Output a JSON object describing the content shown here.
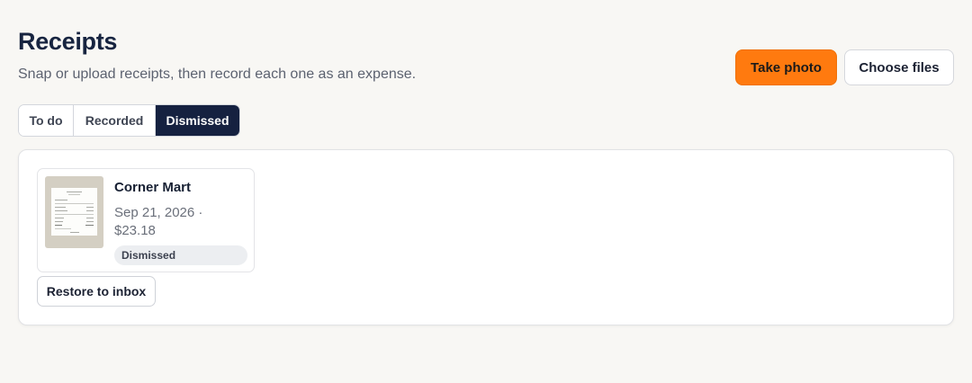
{
  "header": {
    "title": "Receipts",
    "subtitle": "Snap or upload receipts, then record each one as an expense."
  },
  "actions": {
    "take_photo": "Take photo",
    "choose_files": "Choose files"
  },
  "tabs": [
    {
      "label": "To do",
      "active": false
    },
    {
      "label": "Recorded",
      "active": false
    },
    {
      "label": "Dismissed",
      "active": true
    }
  ],
  "receipts": [
    {
      "merchant": "Corner Mart",
      "date_amount": "Sep 21, 2026 · $23.18",
      "status": "Dismissed",
      "restore_label": "Restore to inbox"
    }
  ],
  "colors": {
    "accent": "#ff7a0f",
    "active_tab": "#152140",
    "background": "#f8f7f4"
  }
}
